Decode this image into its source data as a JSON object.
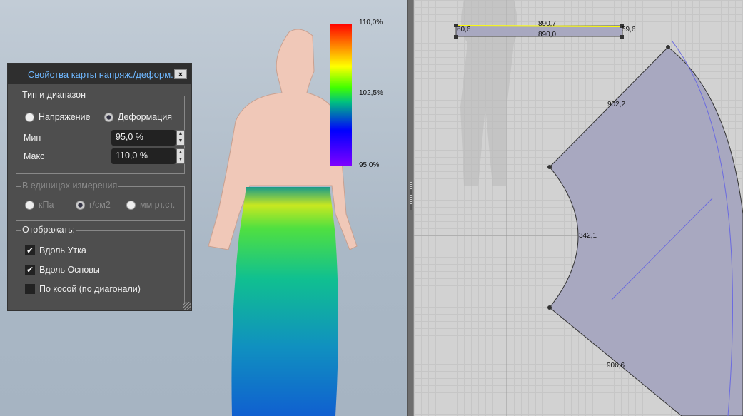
{
  "panel": {
    "title": "Свойства карты напряж./деформ.",
    "close": "×",
    "type_group": {
      "label": "Тип и диапазон",
      "stress": "Напряжение",
      "strain": "Деформация",
      "selected": "strain",
      "min_label": "Мин",
      "min_value": "95,0 %",
      "max_label": "Макс",
      "max_value": "110,0 %"
    },
    "units_group": {
      "label": "В единицах измерения",
      "kpa": "кПа",
      "gcm2": "г/см2",
      "mmhg": "мм рт.ст.",
      "selected": "gcm2"
    },
    "display_group": {
      "label": "Отображать:",
      "weft": "Вдоль Утка",
      "weft_checked": true,
      "warp": "Вдоль Основы",
      "warp_checked": true,
      "bias": "По косой (по диагонали)",
      "bias_checked": false
    }
  },
  "legend": {
    "max": "110,0%",
    "mid": "102,5%",
    "min": "95,0%"
  },
  "pattern": {
    "waistband_top": "890,7",
    "waistband_bottom": "890,0",
    "left_end": "60,6",
    "right_end": "59,6",
    "side_top": "902,2",
    "inner_arc": "342,1",
    "side_bottom": "906,6"
  }
}
